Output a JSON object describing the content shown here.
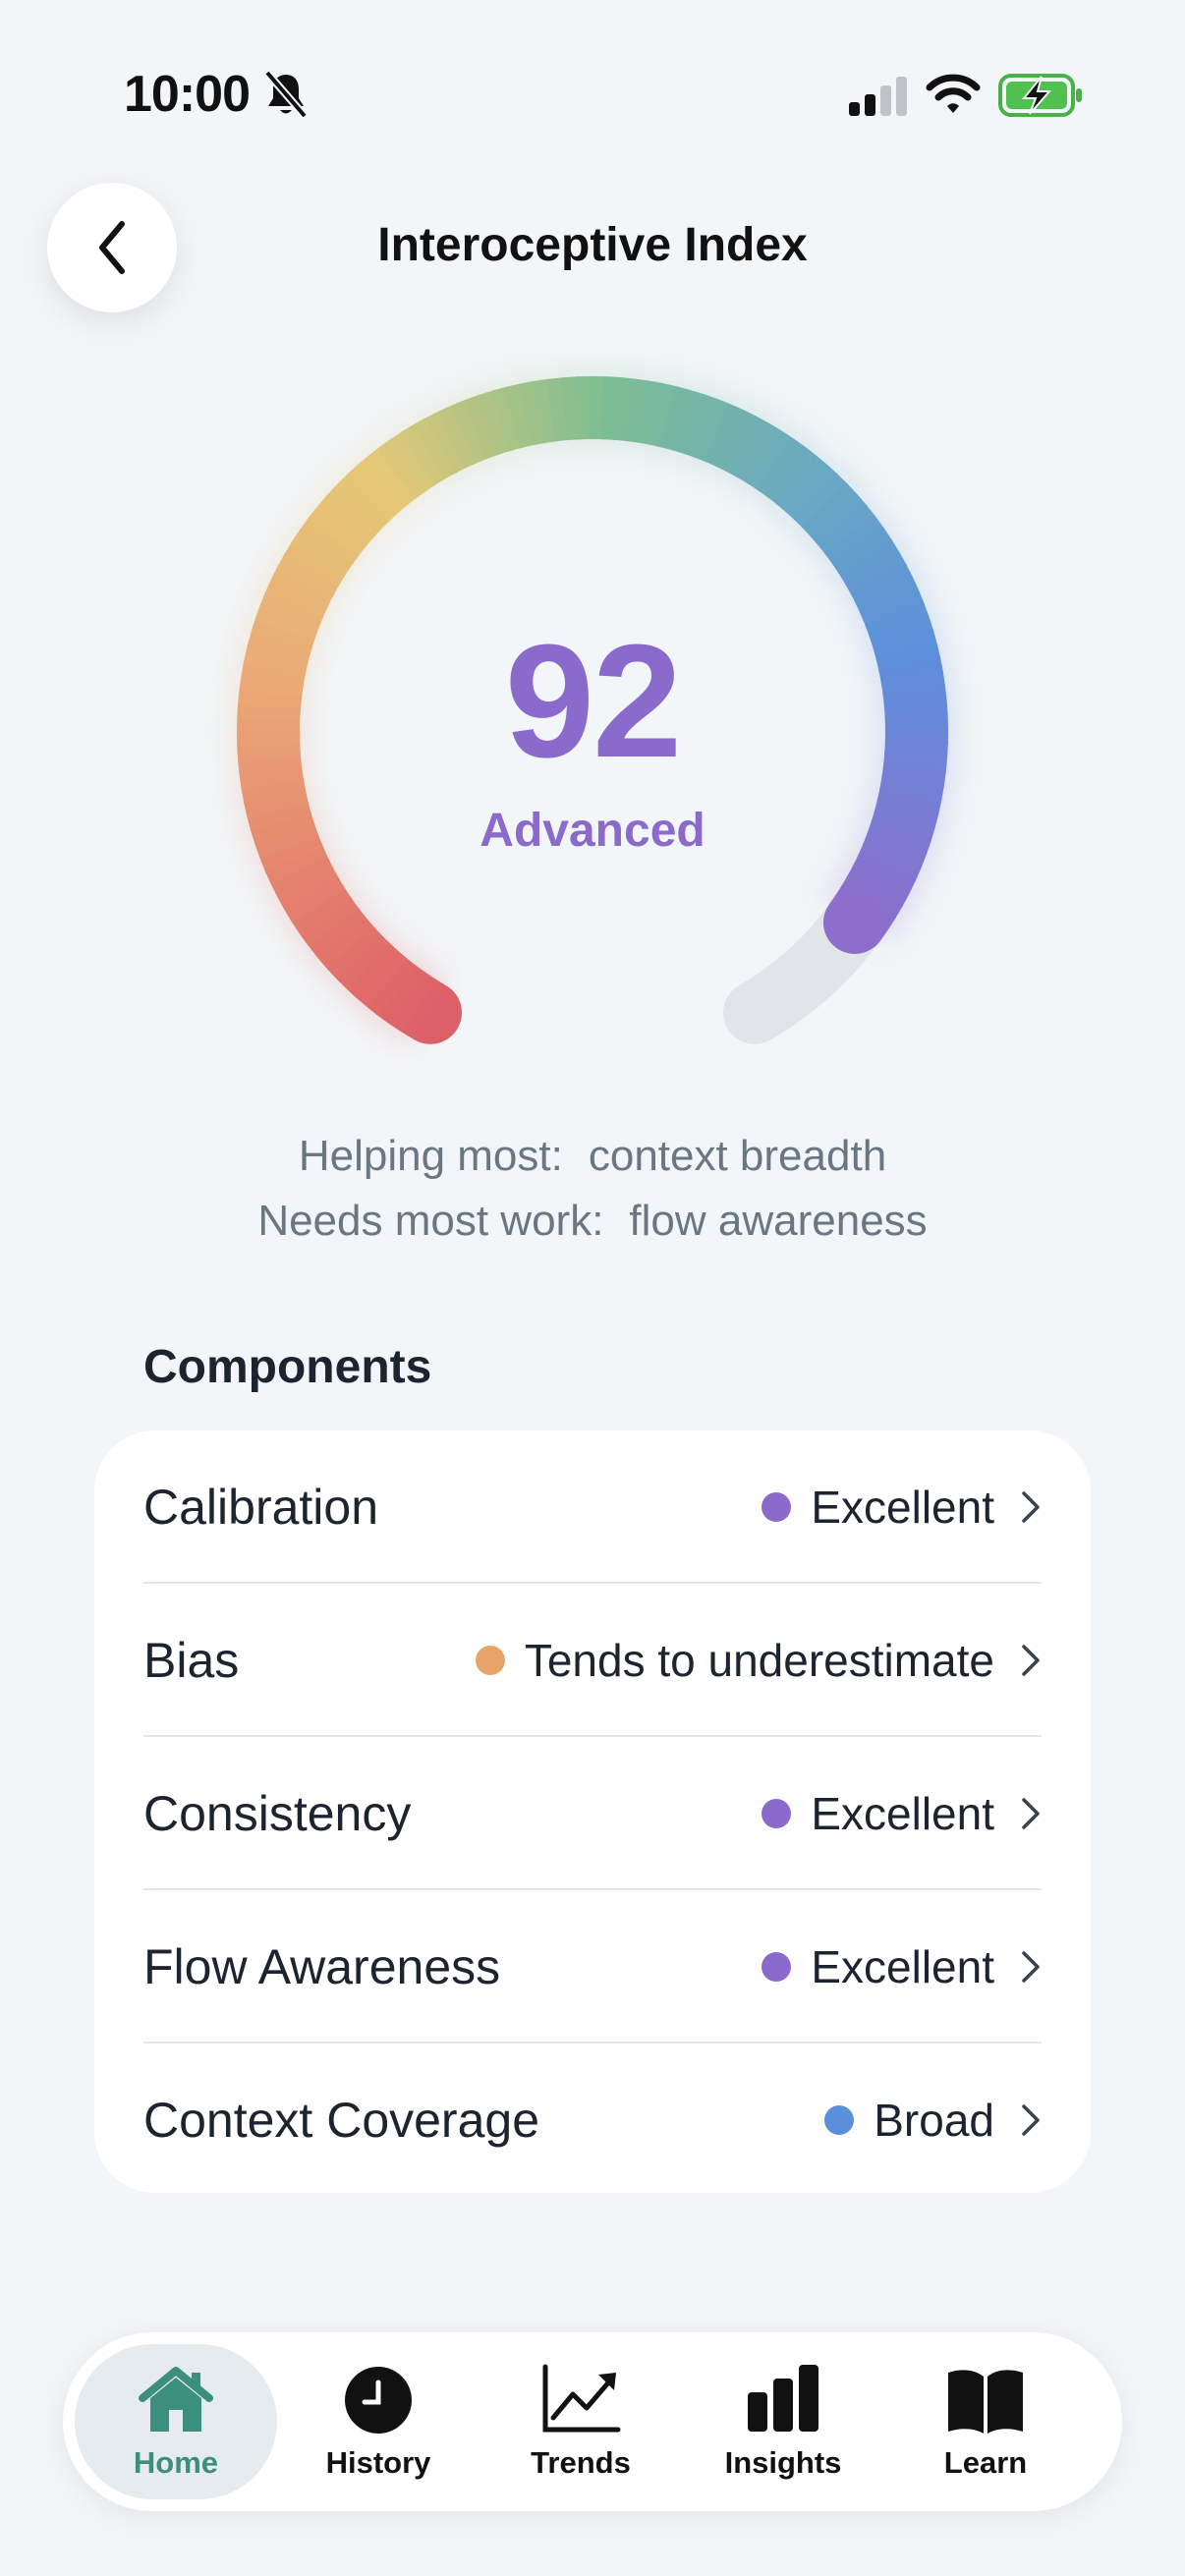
{
  "status_bar": {
    "time": "10:00"
  },
  "header": {
    "title": "Interoceptive Index"
  },
  "score": {
    "value": "92",
    "level": "Advanced",
    "fraction": 0.92
  },
  "insights": {
    "helping_label": "Helping most:",
    "helping_value": "context breadth",
    "needs_label": "Needs most work:",
    "needs_value": "flow awareness"
  },
  "components": {
    "title": "Components",
    "items": [
      {
        "label": "Calibration",
        "value": "Excellent",
        "color": "#8a6bcc"
      },
      {
        "label": "Bias",
        "value": "Tends to underestimate",
        "color": "#e8a368"
      },
      {
        "label": "Consistency",
        "value": "Excellent",
        "color": "#8a6bcc"
      },
      {
        "label": "Flow Awareness",
        "value": "Excellent",
        "color": "#8a6bcc"
      },
      {
        "label": "Context Coverage",
        "value": "Broad",
        "color": "#5b8fdb"
      }
    ]
  },
  "tabs": [
    {
      "label": "Home",
      "icon": "home-icon",
      "active": true
    },
    {
      "label": "History",
      "icon": "clock-icon",
      "active": false
    },
    {
      "label": "Trends",
      "icon": "trend-chart-icon",
      "active": false
    },
    {
      "label": "Insights",
      "icon": "bar-chart-icon",
      "active": false
    },
    {
      "label": "Learn",
      "icon": "book-icon",
      "active": false
    }
  ],
  "colors": {
    "accent": "#8a6bcc",
    "home_active": "#3d8f7d",
    "gauge_track": "#e1e5ea"
  }
}
